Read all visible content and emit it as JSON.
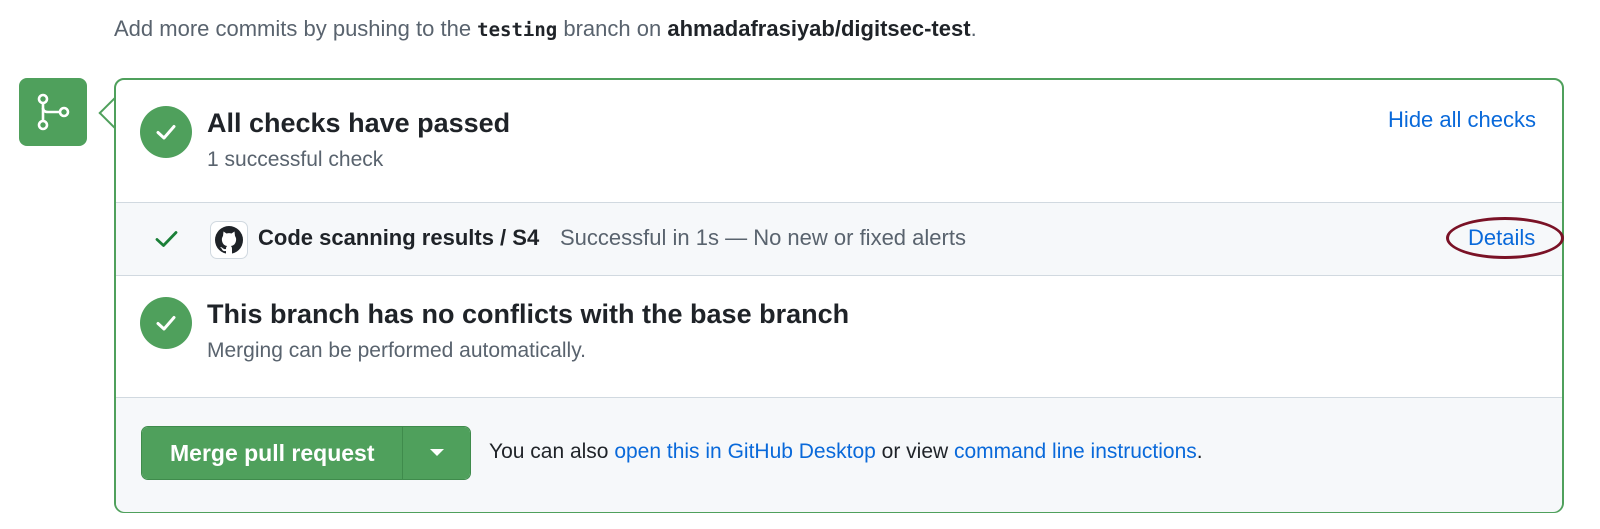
{
  "hint": {
    "prefix": "Add more commits by pushing to the ",
    "branch": "testing",
    "middle": " branch on ",
    "repo": "ahmadafrasiyab/digitsec-test",
    "suffix": "."
  },
  "checks": {
    "title": "All checks have passed",
    "subtitle": "1 successful check",
    "hide_label": "Hide all checks",
    "items": [
      {
        "name": "Code scanning results / S4",
        "status": "Successful in 1s — No new or fixed alerts",
        "details_label": "Details"
      }
    ]
  },
  "conflicts": {
    "title": "This branch has no conflicts with the base branch",
    "subtitle": "Merging can be performed automatically."
  },
  "merge": {
    "button_label": "Merge pull request",
    "also_prefix": "You can also ",
    "desktop_link": "open this in GitHub Desktop",
    "middle": " or view ",
    "cli_link": "command line instructions",
    "suffix": "."
  },
  "colors": {
    "success": "#4fa05c",
    "link": "#0969da",
    "annotation": "#7a1226"
  }
}
